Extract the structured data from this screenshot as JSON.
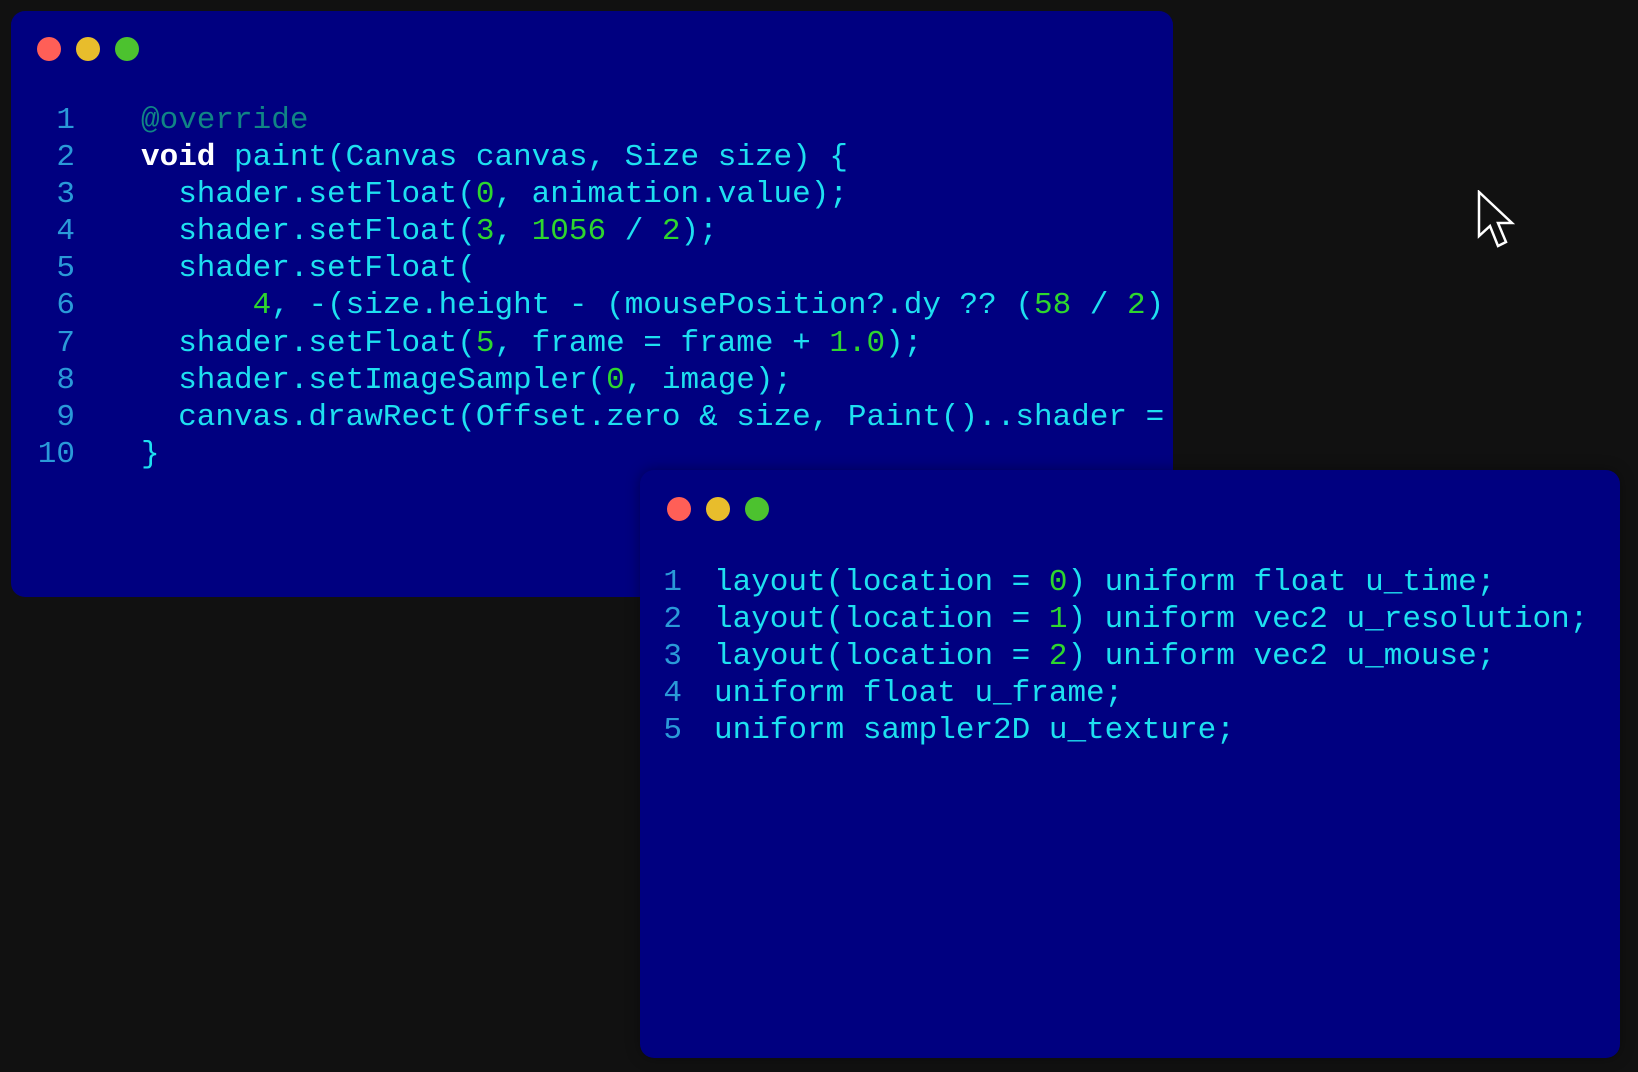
{
  "colors": {
    "background": "#111111",
    "window_bg": "#000080",
    "close_dot": "#FF5F57",
    "minimize_dot": "#E8BD2C",
    "maximize_dot": "#4CC22F",
    "line_number": "#2A9AD8",
    "text": "#1EE0F0",
    "number": "#2ED62E",
    "keyword": "#FFFFFF",
    "annotation": "#108585"
  },
  "windows": [
    {
      "name": "dart-window",
      "controls": [
        "close",
        "minimize",
        "maximize"
      ],
      "lines": [
        {
          "n": "1",
          "tokens": [
            {
              "t": "@override",
              "k": "ann"
            }
          ]
        },
        {
          "n": "2",
          "tokens": [
            {
              "t": "void",
              "k": "kw"
            },
            {
              "t": " paint(Canvas canvas, Size size) {",
              "k": "plain"
            }
          ]
        },
        {
          "n": "3",
          "tokens": [
            {
              "t": "  shader.setFloat(",
              "k": "plain"
            },
            {
              "t": "0",
              "k": "num"
            },
            {
              "t": ", animation.value);",
              "k": "plain"
            }
          ]
        },
        {
          "n": "4",
          "tokens": [
            {
              "t": "  shader.setFloat(",
              "k": "plain"
            },
            {
              "t": "3",
              "k": "num"
            },
            {
              "t": ", ",
              "k": "plain"
            },
            {
              "t": "1056",
              "k": "num"
            },
            {
              "t": " / ",
              "k": "plain"
            },
            {
              "t": "2",
              "k": "num"
            },
            {
              "t": ");",
              "k": "plain"
            }
          ]
        },
        {
          "n": "5",
          "tokens": [
            {
              "t": "  shader.setFloat(",
              "k": "plain"
            }
          ]
        },
        {
          "n": "6",
          "tokens": [
            {
              "t": "      ",
              "k": "plain"
            },
            {
              "t": "4",
              "k": "num"
            },
            {
              "t": ", -(size.height - (mousePosition?.dy ?? (",
              "k": "plain"
            },
            {
              "t": "58",
              "k": "num"
            },
            {
              "t": " / ",
              "k": "plain"
            },
            {
              "t": "2",
              "k": "num"
            },
            {
              "t": ")",
              "k": "plain"
            }
          ]
        },
        {
          "n": "7",
          "tokens": [
            {
              "t": "  shader.setFloat(",
              "k": "plain"
            },
            {
              "t": "5",
              "k": "num"
            },
            {
              "t": ", frame = frame + ",
              "k": "plain"
            },
            {
              "t": "1.0",
              "k": "num"
            },
            {
              "t": ");",
              "k": "plain"
            }
          ]
        },
        {
          "n": "8",
          "tokens": [
            {
              "t": "  shader.setImageSampler(",
              "k": "plain"
            },
            {
              "t": "0",
              "k": "num"
            },
            {
              "t": ", image);",
              "k": "plain"
            }
          ]
        },
        {
          "n": "9",
          "tokens": [
            {
              "t": "  canvas.drawRect(Offset.zero & size, Paint()..shader =",
              "k": "plain"
            }
          ]
        },
        {
          "n": "10",
          "tokens": [
            {
              "t": "}",
              "k": "plain"
            }
          ]
        }
      ]
    },
    {
      "name": "glsl-window",
      "controls": [
        "close",
        "minimize",
        "maximize"
      ],
      "lines": [
        {
          "n": "1",
          "tokens": [
            {
              "t": "layout(location = ",
              "k": "plain"
            },
            {
              "t": "0",
              "k": "num"
            },
            {
              "t": ") uniform float u_time;",
              "k": "plain"
            }
          ]
        },
        {
          "n": "2",
          "tokens": [
            {
              "t": "layout(location = ",
              "k": "plain"
            },
            {
              "t": "1",
              "k": "num"
            },
            {
              "t": ") uniform vec2 u_resolution;",
              "k": "plain"
            }
          ]
        },
        {
          "n": "3",
          "tokens": [
            {
              "t": "layout(location = ",
              "k": "plain"
            },
            {
              "t": "2",
              "k": "num"
            },
            {
              "t": ") uniform vec2 u_mouse;",
              "k": "plain"
            }
          ]
        },
        {
          "n": "4",
          "tokens": [
            {
              "t": "uniform float u_frame;",
              "k": "plain"
            }
          ]
        },
        {
          "n": "5",
          "tokens": [
            {
              "t": "uniform sampler2D u_texture;",
              "k": "plain"
            }
          ]
        }
      ]
    }
  ],
  "cursor": {
    "icon": "arrow-pointer-icon"
  }
}
